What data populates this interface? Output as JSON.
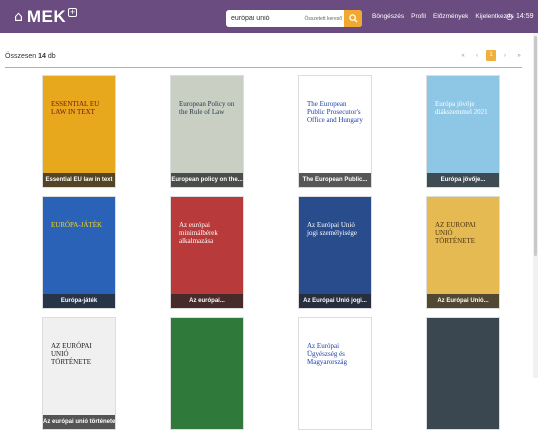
{
  "header": {
    "logo_icon": "building-icon",
    "logo_text": "MEK",
    "logo_plus": "+",
    "search_value": "európai unió",
    "search_mode": "Összetett kereső",
    "nav": [
      "Böngészés",
      "Profil",
      "Előzmények",
      "Kijelentkezés"
    ],
    "time": "14:59",
    "accent": "#f0a830",
    "bar_color": "#6a4c80"
  },
  "results": {
    "prefix": "Összesen",
    "count": "14",
    "suffix": "db"
  },
  "pager": {
    "first": "«",
    "prev": "‹",
    "current": "1",
    "next": "›",
    "last": "»"
  },
  "books": [
    {
      "caption": "Essential EU law in text",
      "cover_title": "ESSENTIAL EU LAW IN TEXT",
      "bg": "#e8a81e",
      "fg": "#7a1010"
    },
    {
      "caption": "European policy on the...",
      "cover_title": "European Policy on the Rule of Law",
      "bg": "#c9cfc2",
      "fg": "#2a3a50"
    },
    {
      "caption": "The European Public...",
      "cover_title": "The European Public Prosecutor's Office and Hungary",
      "bg": "#ffffff",
      "fg": "#1e3fa8"
    },
    {
      "caption": "Európa jövője...",
      "cover_title": "Európa jövője diákszemmel 2021",
      "bg": "#8ec6e6",
      "fg": "#ffffff"
    },
    {
      "caption": "Európa-játék",
      "cover_title": "EURÓPA-JÁTÉK",
      "bg": "#2a62b8",
      "fg": "#f5d21a"
    },
    {
      "caption": "Az európai...",
      "cover_title": "Az európai minimálbérek alkalmazása",
      "bg": "#b83a3a",
      "fg": "#ffffff"
    },
    {
      "caption": "Az Európai Unió jogi...",
      "cover_title": "Az Európai Unió jogi személyisége",
      "bg": "#284c8c",
      "fg": "#ffffff"
    },
    {
      "caption": "Az Európai Unió...",
      "cover_title": "AZ EUROPAI UNIÓ TÖRTÉNETE",
      "bg": "#e6ba52",
      "fg": "#4a3210"
    },
    {
      "caption": "Az európai unió története",
      "cover_title": "AZ EURÓPAI UNIÓ TÖRTÉNETE",
      "bg": "#f0f0f0",
      "fg": "#1a1a1a"
    },
    {
      "caption": "",
      "cover_title": "",
      "bg": "#2f7a3a",
      "fg": "#ffffff"
    },
    {
      "caption": "",
      "cover_title": "Az Európai Ügyészség és Magyarország",
      "bg": "#ffffff",
      "fg": "#1e3fa8"
    },
    {
      "caption": "",
      "cover_title": "",
      "bg": "#3a4650",
      "fg": "#ffffff"
    }
  ]
}
